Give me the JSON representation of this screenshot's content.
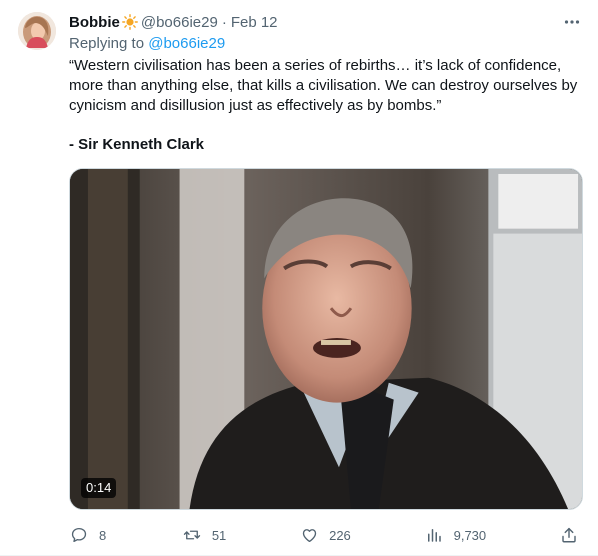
{
  "tweet": {
    "author": {
      "display_name": "Bobbie",
      "handle": "@bo66ie29",
      "emoji_icon": "sun-icon"
    },
    "date": "Feb 12",
    "reply": {
      "prefix": "Replying to",
      "handle": "@bo66ie29"
    },
    "text": "“Western civilisation has been a series of rebirths… it’s lack of confidence, more than anything else, that kills a civilisation. We can destroy ourselves by cynicism and disillusion just as effectively as by bombs.”",
    "attribution": "- Sir Kenneth Clark",
    "media": {
      "duration": "0:14"
    },
    "actions": {
      "replies": "8",
      "retweets": "51",
      "likes": "226",
      "views": "9,730"
    }
  },
  "colors": {
    "text": "#0f1419",
    "muted": "#536471",
    "link": "#1d9bf0",
    "sun": "#f5a623"
  }
}
